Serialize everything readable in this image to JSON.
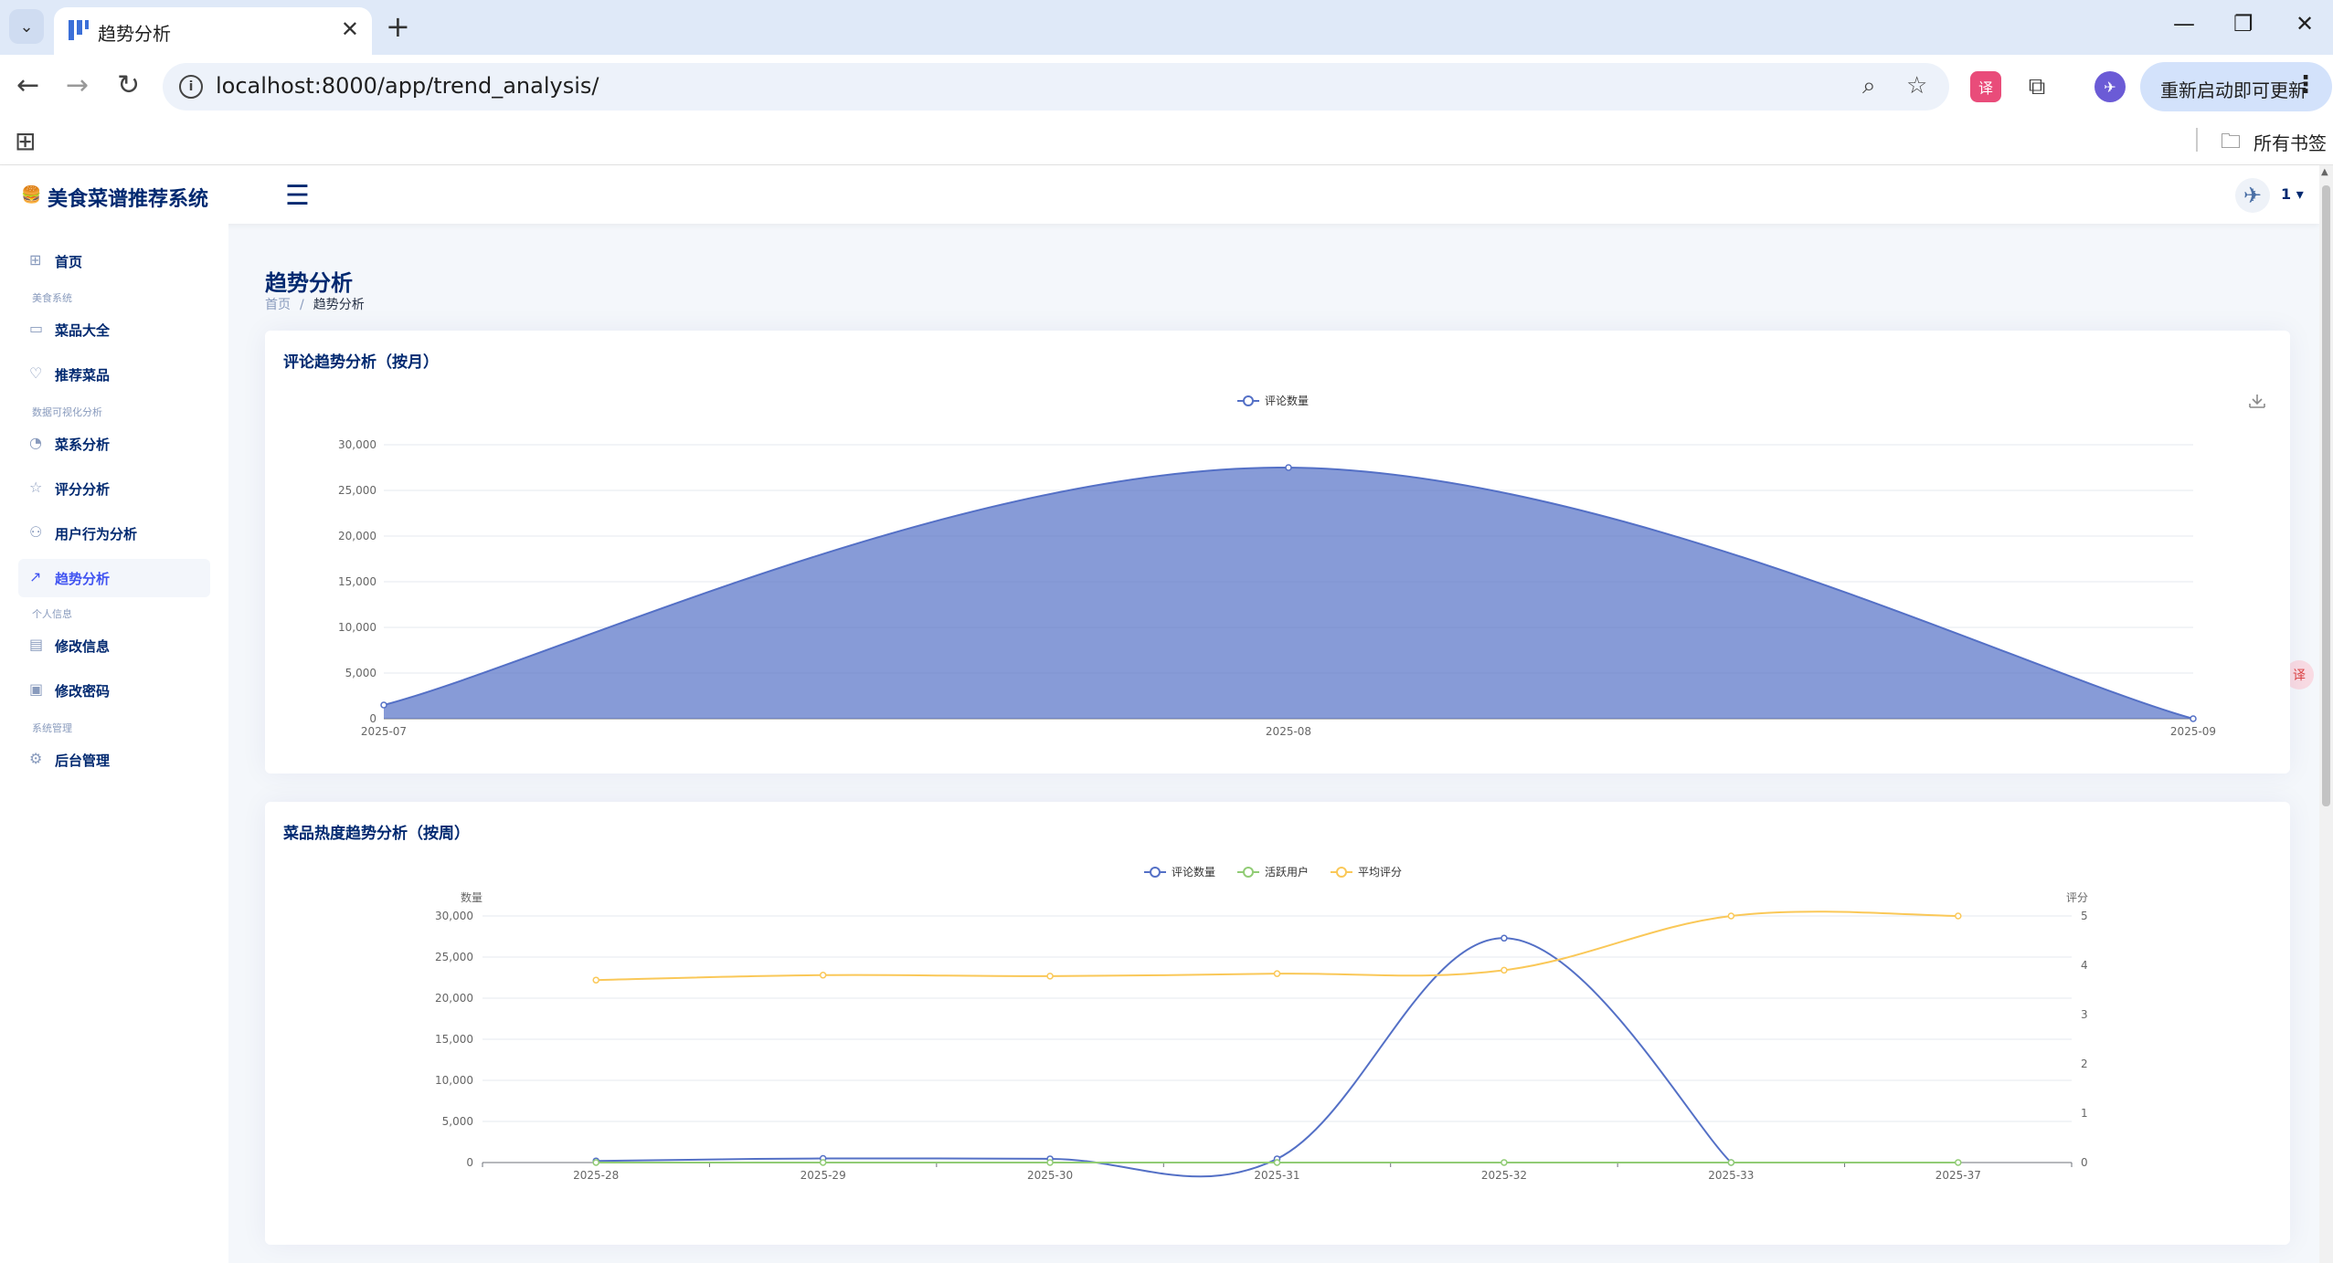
{
  "browser": {
    "tab_title": "趋势分析",
    "url": "localhost:8000/app/trend_analysis/",
    "update_label": "重新启动即可更新",
    "bookmarks_label": "所有书签"
  },
  "app": {
    "brand": "美食菜谱推荐系统",
    "user": "1"
  },
  "sidebar": {
    "items": [
      {
        "label": "首页",
        "icon": "grid-icon"
      },
      {
        "heading": "美食系统"
      },
      {
        "label": "菜品大全",
        "icon": "box-icon"
      },
      {
        "label": "推荐菜品",
        "icon": "heart-icon"
      },
      {
        "heading": "数据可视化分析"
      },
      {
        "label": "菜系分析",
        "icon": "pie-chart-icon"
      },
      {
        "label": "评分分析",
        "icon": "star-icon"
      },
      {
        "label": "用户行为分析",
        "icon": "people-icon"
      },
      {
        "label": "趋势分析",
        "icon": "graph-up-icon",
        "active": true
      },
      {
        "heading": "个人信息"
      },
      {
        "label": "修改信息",
        "icon": "card-icon"
      },
      {
        "label": "修改密码",
        "icon": "file-lock-icon"
      },
      {
        "heading": "系统管理"
      },
      {
        "label": "后台管理",
        "icon": "gear-icon"
      }
    ]
  },
  "page": {
    "title": "趋势分析",
    "breadcrumb_home": "首页",
    "breadcrumb_sep": "/",
    "breadcrumb_current": "趋势分析"
  },
  "colors": {
    "blue": "#5470c6",
    "green": "#91cc75",
    "yellow": "#fac858"
  },
  "chart_data": [
    {
      "type": "area",
      "title": "评论趋势分析（按月）",
      "x": [
        "2025-07",
        "2025-08",
        "2025-09"
      ],
      "series": [
        {
          "name": "评论数量",
          "values": [
            1500,
            27500,
            0
          ]
        }
      ],
      "ylim": [
        0,
        30000
      ],
      "yticks": [
        "0",
        "5,000",
        "10,000",
        "15,000",
        "20,000",
        "25,000",
        "30,000"
      ],
      "legend": "top-center",
      "grid": true
    },
    {
      "type": "line",
      "title": "菜品热度趋势分析（按周）",
      "x": [
        "2025-28",
        "2025-29",
        "2025-30",
        "2025-31",
        "2025-32",
        "2025-33",
        "2025-37"
      ],
      "series": [
        {
          "name": "评论数量",
          "axis": "left",
          "values": [
            200,
            500,
            450,
            450,
            27300,
            0,
            null
          ]
        },
        {
          "name": "活跃用户",
          "axis": "left",
          "values": [
            5,
            5,
            5,
            5,
            5,
            5,
            5
          ]
        },
        {
          "name": "平均评分",
          "axis": "right",
          "values": [
            3.7,
            3.8,
            3.78,
            3.83,
            3.9,
            5.0,
            5.0
          ]
        }
      ],
      "ylabel_left": "数量",
      "ylabel_right": "评分",
      "ylim_left": [
        0,
        30000
      ],
      "ylim_right": [
        0,
        5
      ],
      "yticks_left": [
        "0",
        "5,000",
        "10,000",
        "15,000",
        "20,000",
        "25,000",
        "30,000"
      ],
      "yticks_right": [
        "0",
        "1",
        "2",
        "3",
        "4",
        "5"
      ],
      "legend": "top-center",
      "grid": true
    }
  ]
}
